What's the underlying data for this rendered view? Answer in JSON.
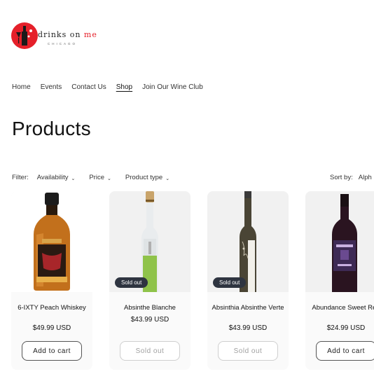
{
  "brand": {
    "logo_main": "drinks on me",
    "logo_accent": "me",
    "logo_sub": "CHICAGO"
  },
  "nav": {
    "items": [
      {
        "label": "Home"
      },
      {
        "label": "Events"
      },
      {
        "label": "Contact Us"
      },
      {
        "label": "Shop"
      },
      {
        "label": "Join Our Wine Club"
      }
    ],
    "active_index": 3
  },
  "page": {
    "title": "Products"
  },
  "filters": {
    "label": "Filter:",
    "items": [
      {
        "label": "Availability"
      },
      {
        "label": "Price"
      },
      {
        "label": "Product type"
      }
    ]
  },
  "sort": {
    "label": "Sort by:",
    "value": "Alph"
  },
  "products": [
    {
      "name": "6-IXTY Peach Whiskey",
      "price": "$49.99 USD",
      "button": "Add to cart",
      "sold_out": false,
      "badge": ""
    },
    {
      "name": "Absinthe Blanche",
      "price": "$43.99 USD",
      "button": "Sold out",
      "sold_out": true,
      "badge": "Sold out"
    },
    {
      "name": "Absinthia Absinthe Verte",
      "price": "$43.99 USD",
      "button": "Sold out",
      "sold_out": true,
      "badge": "Sold out"
    },
    {
      "name": "Abundance Sweet Red",
      "price": "$24.99 USD",
      "button": "Add to cart",
      "sold_out": false,
      "badge": ""
    }
  ],
  "colors": {
    "brand_red": "#e5202a",
    "badge_bg": "#2e3440",
    "text": "#121212"
  }
}
